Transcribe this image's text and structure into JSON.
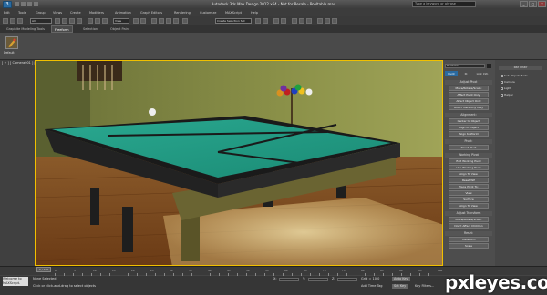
{
  "window": {
    "title": "Autodesk 3ds Max Design 2012 x64 - Not for Resale - Pooltable.max",
    "search_placeholder": "Type a keyword or phrase",
    "app_button": "3"
  },
  "menubar": {
    "items": [
      "Edit",
      "Tools",
      "Group",
      "Views",
      "Create",
      "Modifiers",
      "Animation",
      "Graph Editors",
      "Rendering",
      "Customize",
      "MAXScript",
      "Help"
    ]
  },
  "toolbar": {
    "selection_filter": "All",
    "view_dropdown": "View",
    "named_sets": "Create Selection Set"
  },
  "ribbon": {
    "tabs": [
      "Graphite Modeling Tools",
      "Freeform",
      "Selection",
      "Object Paint"
    ],
    "active_tab": "Freeform",
    "tool_label": "Default"
  },
  "viewport": {
    "label": "[ + ] [ Camera001 ] [ Shaded ]"
  },
  "command_panel": {
    "selected_object": "Pooltable",
    "groups": [
      {
        "title": "Adjust Pivot",
        "buttons": [
          "Move/Rotate/Scale:",
          "Affect Pivot Only",
          "Affect Object Only",
          "Affect Hierarchy Only"
        ]
      },
      {
        "title": "Alignment:",
        "buttons": [
          "Center to Object",
          "Align to Object",
          "Align to World"
        ]
      },
      {
        "title": "Pivot:",
        "buttons": [
          "Reset Pivot"
        ]
      },
      {
        "title": "Working Pivot",
        "buttons": [
          "Edit Working Pivot",
          "Use Working Pivot",
          "Align To View",
          "Reset WP",
          "Place Pivot To:",
          "View",
          "Surface",
          "Align To View"
        ]
      },
      {
        "title": "Adjust Transform",
        "buttons": [
          "Move/Rotate/Scale:",
          "Don't Affect Children"
        ]
      },
      {
        "title": "Reset:",
        "buttons": [
          "Transform",
          "Scale"
        ]
      }
    ],
    "tabs": [
      "Pivot",
      "IK",
      "Link Info"
    ]
  },
  "render_panel": {
    "title": "Bar Chair",
    "items": [
      "Sub-Object Mode",
      "Camera",
      "Light",
      "Helper"
    ]
  },
  "timeline": {
    "frame": "0 / 100",
    "frame_labels": [
      "0",
      "5",
      "10",
      "15",
      "20",
      "25",
      "30",
      "35",
      "40",
      "45",
      "50",
      "55",
      "60",
      "65",
      "70",
      "75",
      "80",
      "85",
      "90",
      "95",
      "100"
    ]
  },
  "status": {
    "welcome": "Welcome to MAXScript.",
    "selection": "None Selected",
    "hint": "Click or click-and-drag to select objects",
    "x": "X:",
    "y": "Y:",
    "z": "Z:",
    "grid": "Grid = 10.0",
    "auto_key": "Auto Key",
    "set_key": "Set Key",
    "key_filters": "Key Filters...",
    "add_time_tag": "Add Time Tag"
  },
  "watermark": "pxleyes.com"
}
